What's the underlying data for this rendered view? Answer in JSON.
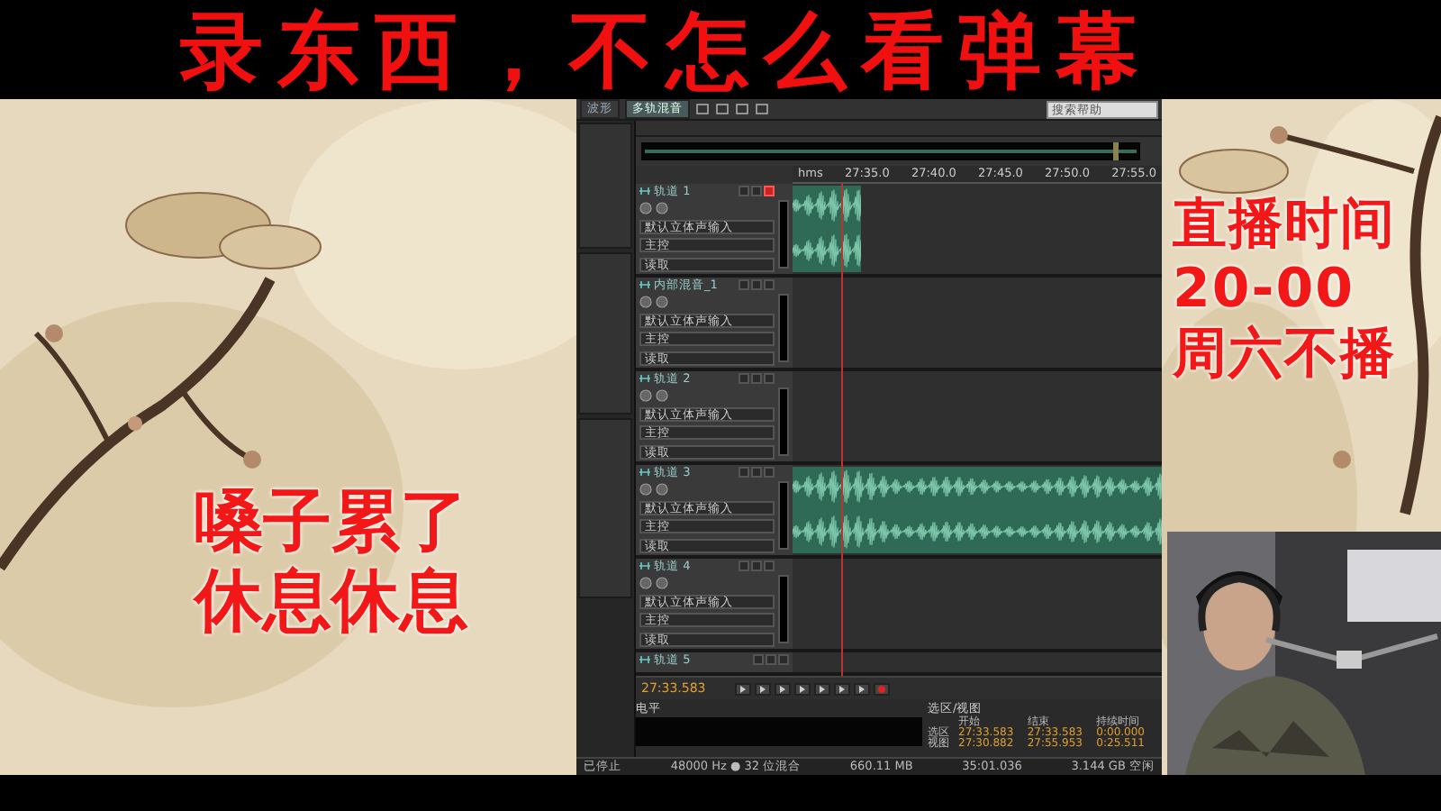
{
  "banner": {
    "title": "录东西，不怎么看弹幕"
  },
  "left_overlay": {
    "lines": [
      "嗓子累了",
      "休息休息"
    ]
  },
  "right_overlay": {
    "lines": [
      "直播时间",
      "20-00",
      "周六不播"
    ]
  },
  "editor": {
    "workspace_tabs": [
      {
        "label": "波形",
        "selected": false
      },
      {
        "label": "多轨混音",
        "selected": true
      }
    ],
    "search": {
      "placeholder": "搜索帮助"
    },
    "timeline": {
      "ticks": [
        "hms",
        "27:35.0",
        "27:40.0",
        "27:45.0",
        "27:50.0",
        "27:55.0"
      ]
    },
    "tracks": [
      {
        "name": "轨道 1",
        "armed": true,
        "collapsed": false,
        "kind": "short-clip",
        "input": "默认立体声输入",
        "output": "主控",
        "automation": "读取"
      },
      {
        "name": "内部混音_1",
        "armed": false,
        "collapsed": false,
        "kind": "empty",
        "input": "默认立体声输入",
        "output": "主控",
        "automation": "读取"
      },
      {
        "name": "轨道 2",
        "armed": false,
        "collapsed": false,
        "kind": "empty",
        "input": "默认立体声输入",
        "output": "主控",
        "automation": "读取"
      },
      {
        "name": "轨道 3",
        "armed": false,
        "collapsed": false,
        "kind": "full-clip",
        "input": "默认立体声输入",
        "output": "主控",
        "automation": "读取"
      },
      {
        "name": "轨道 4",
        "armed": false,
        "collapsed": false,
        "kind": "empty",
        "input": "默认立体声输入",
        "output": "主控",
        "automation": "读取"
      },
      {
        "name": "轨道 5",
        "armed": false,
        "collapsed": true,
        "kind": "empty"
      }
    ],
    "transport": {
      "time": "27:33.583"
    },
    "meter": {
      "tab": "电平"
    },
    "selection": {
      "tab": "选区/视图",
      "columns": [
        "开始",
        "结束",
        "持续时间"
      ],
      "rows": [
        {
          "label": "选区",
          "values": [
            "27:33.583",
            "27:33.583",
            "0:00.000"
          ]
        },
        {
          "label": "视图",
          "values": [
            "27:30.882",
            "27:55.953",
            "0:25.511"
          ]
        }
      ]
    },
    "status_bar": [
      "已停止",
      "48000 Hz ● 32 位混合",
      "660.11 MB",
      "35:01.036",
      "3.144 GB 空闲"
    ]
  }
}
